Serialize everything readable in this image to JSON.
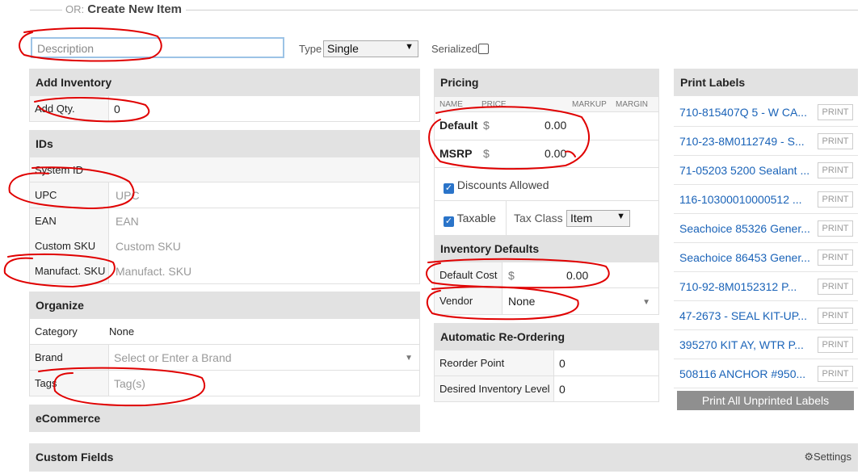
{
  "header": {
    "prefix": "OR:",
    "title": "Create New Item"
  },
  "description": {
    "placeholder": "Description"
  },
  "type": {
    "label": "Type",
    "value": "Single"
  },
  "serialized": {
    "label": "Serialized"
  },
  "add_inventory": {
    "title": "Add Inventory",
    "qty_label": "Add Qty.",
    "qty_value": "0"
  },
  "ids": {
    "title": "IDs",
    "system_id": "System ID",
    "upc": {
      "label": "UPC",
      "placeholder": "UPC"
    },
    "ean": {
      "label": "EAN",
      "placeholder": "EAN"
    },
    "custom_sku": {
      "label": "Custom SKU",
      "placeholder": "Custom SKU"
    },
    "manufact_sku": {
      "label": "Manufact. SKU",
      "placeholder": "Manufact. SKU"
    }
  },
  "organize": {
    "title": "Organize",
    "category_label": "Category",
    "category_value": "None",
    "brand_label": "Brand",
    "brand_placeholder": "Select or Enter a Brand",
    "tags_label": "Tags",
    "tags_placeholder": "Tag(s)"
  },
  "ecommerce": {
    "title": "eCommerce"
  },
  "custom_fields": {
    "title": "Custom Fields",
    "settings_label": "Settings"
  },
  "pricing": {
    "title": "Pricing",
    "col_name": "NAME",
    "col_price": "PRICE",
    "col_markup": "MARKUP",
    "col_margin": "MARGIN",
    "default_label": "Default",
    "default_currency": "$",
    "default_value": "0.00",
    "msrp_label": "MSRP",
    "msrp_currency": "$",
    "msrp_value": "0.00",
    "discounts_label": "Discounts Allowed",
    "taxable_label": "Taxable",
    "tax_class_label": "Tax Class",
    "tax_class_value": "Item"
  },
  "inventory_defaults": {
    "title": "Inventory Defaults",
    "default_cost_label": "Default Cost",
    "default_cost_currency": "$",
    "default_cost_value": "0.00",
    "vendor_label": "Vendor",
    "vendor_value": "None"
  },
  "reordering": {
    "title": "Automatic Re-Ordering",
    "reorder_point_label": "Reorder Point",
    "reorder_point_value": "0",
    "desired_level_label": "Desired Inventory Level",
    "desired_level_value": "0"
  },
  "print_labels": {
    "title": "Print Labels",
    "print_label": "PRINT",
    "items": [
      "710-815407Q 5 - W CA...",
      "710-23-8M0112749 - S...",
      "71-05203 5200 Sealant ...",
      "116-10300010000512 ...",
      "Seachoice 85326 Gener...",
      "Seachoice 86453 Gener...",
      "710-92-8M0152312 P...",
      "47-2673 - SEAL KIT-UP...",
      "395270 KIT AY, WTR P...",
      "508116 ANCHOR #950..."
    ],
    "print_all_label": "Print All Unprinted Labels"
  },
  "colors": {
    "accent": "#1a63b8",
    "section_bg": "#e2e2e2",
    "annotation": "#e00000"
  }
}
